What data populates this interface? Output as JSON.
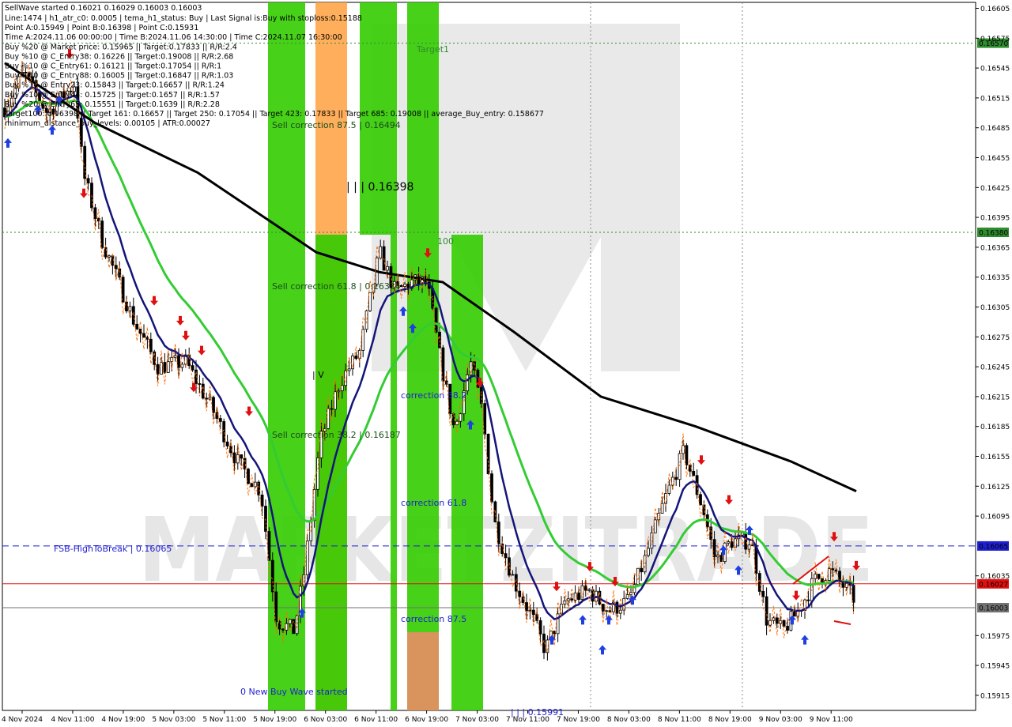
{
  "chart_data": {
    "type": "candlestick",
    "symbol_line": "SellWave started",
    "ohlc_header": "0.16021 0.16029 0.16003 0.16003",
    "current_price": 0.16003,
    "ylim": [
      0.1592,
      0.1661
    ],
    "y_ticks": [
      0.16605,
      0.16575,
      0.16545,
      0.16515,
      0.16485,
      0.16455,
      0.16425,
      0.16395,
      0.16365,
      0.16335,
      0.16305,
      0.16275,
      0.16245,
      0.16215,
      0.16185,
      0.16155,
      0.16125,
      0.16095,
      0.16035,
      0.15975,
      0.15945,
      0.15915
    ],
    "x_ticks": [
      "4 Nov 2024",
      "4 Nov 11:00",
      "4 Nov 19:00",
      "5 Nov 03:00",
      "5 Nov 11:00",
      "5 Nov 19:00",
      "6 Nov 03:00",
      "6 Nov 11:00",
      "6 Nov 19:00",
      "7 Nov 03:00",
      "7 Nov 11:00",
      "7 Nov 19:00",
      "8 Nov 03:00",
      "8 Nov 11:00",
      "8 Nov 19:00",
      "9 Nov 03:00",
      "9 Nov 11:00"
    ],
    "horizontal_levels": [
      {
        "label": "0.16570",
        "value": 0.1657,
        "color": "#2e8b2e",
        "style": "dotted"
      },
      {
        "label": "0.16380",
        "value": 0.1638,
        "color": "#2e8b2e",
        "style": "dotted"
      },
      {
        "label": "0.16065",
        "value": 0.16065,
        "color": "#1f1fd0",
        "style": "dashed"
      },
      {
        "label": "0.16027",
        "value": 0.16027,
        "color": "#e01010",
        "style": "solid"
      },
      {
        "label": "0.16003",
        "value": 0.16003,
        "color": "#707070",
        "style": "solid"
      }
    ],
    "text_annotations": {
      "target1": "Target1",
      "sell_corr_875": "Sell correction 87.5 | 0.16494",
      "sell_corr_618": "Sell correction 61.8 | 0.16334",
      "sell_corr_382": "Sell correction 38.2 | 0.16187",
      "peak": "| | | 0.16398",
      "hundred": "100",
      "correction_382": "correction 38.2",
      "correction_618": "correction 61.8",
      "correction_875": "correction 87.5",
      "fsb": "FSB-HighToBreak | 0.16065",
      "new_wave": "0 New Buy Wave started",
      "bottom_partial": "| | | 0.15991",
      "small_v": "| V"
    },
    "info_lines": [
      "Line:1474 | h1_atr_c0: 0.0005 | tema_h1_status: Buy | Last Signal is:Buy with stoploss:0.15188",
      "Point A:0.15949 | Point B:0.16398 | Point C:0.15931",
      "Time A:2024.11.06 00:00:00 | Time B:2024.11.06 14:30:00 | Time C:2024.11.07 16:30:00",
      "Buy %20 @ Market price: 0.15965 || Target:0.17833 || R/R:2.4",
      "Buy %10 @ C_Entry38: 0.16226 || Target:0.19008 || R/R:2.68",
      "Buy %10 @ C_Entry61: 0.16121 || Target:0.17054 || R/R:1",
      "Buy %10 @ C_Entry88: 0.16005 || Target:0.16847 || R/R:1.03",
      "Buy %10 @ Entry23: 0.15843 || Target:0.16657 || R/R:1.24",
      "Buy %10 @ Entry44: 0.15725 || Target:0.1657 || R/R:1.57",
      "Buy %20 @ Entry65: 0.15551 || Target:0.1639 || R/R:2.28",
      "Target100: 0.16398 || Target 161: 0.16657 || Target 250: 0.17054 || Target 423: 0.17833 || Target 685: 0.19008 || average_Buy_entry: 0.158677",
      "minimum_distance_buy_levels: 0.00105 | ATR:0.00027"
    ],
    "watermark": "MARKETZITRADE"
  }
}
